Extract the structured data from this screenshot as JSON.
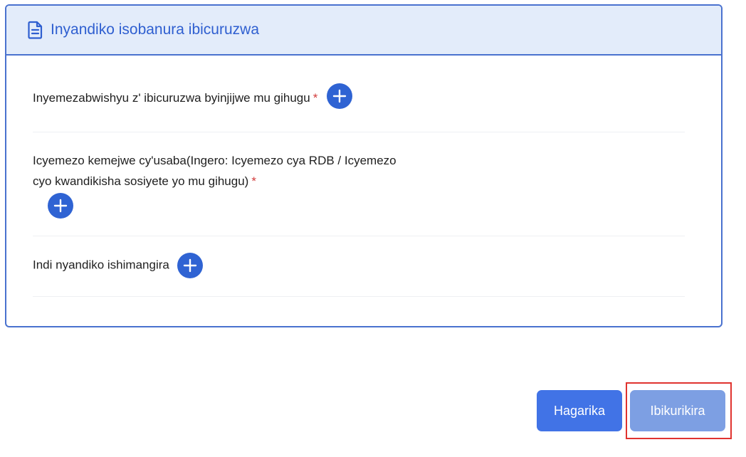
{
  "card": {
    "title": "Inyandiko isobanura ibicuruzwa",
    "title_icon": "document-icon"
  },
  "rows": [
    {
      "label": "Inyemezabwishyu z' ibicuruzwa byinjijwe mu gihugu",
      "required_mark": "*"
    },
    {
      "label_line1": "Icyemezo kemejwe cy'usaba(Ingero: Icyemezo cya RDB / Icyemezo",
      "label_line2": "cyo kwandikisha sosiyete yo mu gihugu)",
      "required_mark": "*"
    },
    {
      "label": "Indi nyandiko ishimangira"
    }
  ],
  "buttons": {
    "cancel_label": "Hagarika",
    "submit_label": "Ibikurikira"
  },
  "colors": {
    "accent": "#2f63d3",
    "header_bg": "#e3ecfa",
    "required": "#d23b3b",
    "highlight": "#e0332f"
  }
}
